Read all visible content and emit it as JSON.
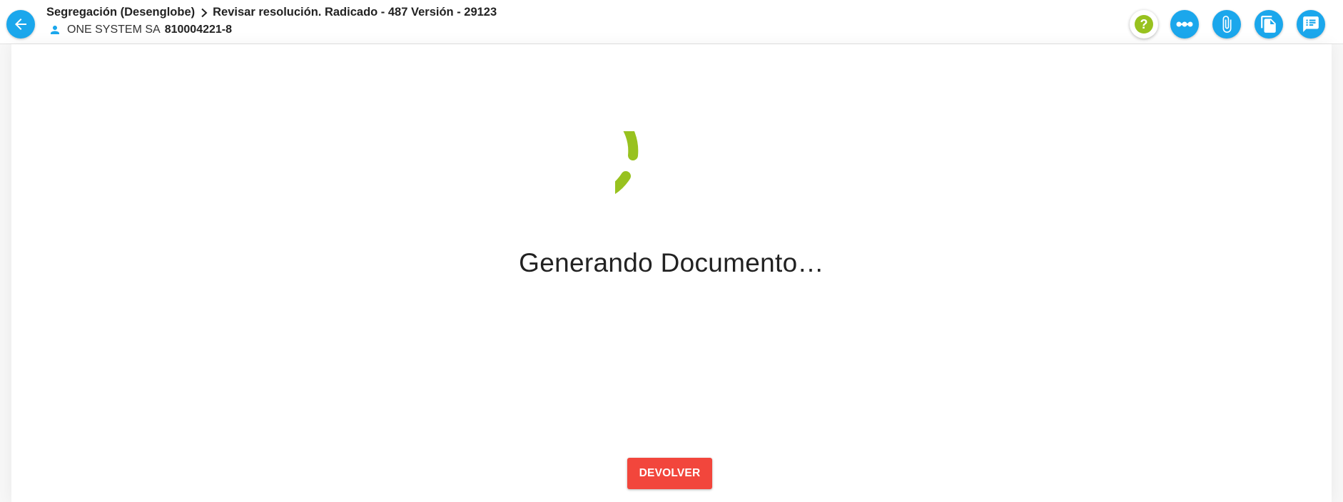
{
  "header": {
    "breadcrumb": {
      "parent": "Segregación (Desenglobe)",
      "current": "Revisar resolución. Radicado - 487 Versión - 29123"
    },
    "company": {
      "name": "ONE SYSTEM SA",
      "nit": "810004221-8"
    },
    "actions": [
      {
        "icon": "help-icon"
      },
      {
        "icon": "workflow-icon"
      },
      {
        "icon": "attachment-icon"
      },
      {
        "icon": "copy-icon"
      },
      {
        "icon": "comments-icon"
      }
    ]
  },
  "main": {
    "loading_text": "Generando Documento…",
    "spinner_color": "#98c21f"
  },
  "footer": {
    "devolver_label": "DEVOLVER"
  },
  "colors": {
    "primary": "#1ba7ec",
    "accent": "#98c21f",
    "danger": "#f2463c"
  }
}
